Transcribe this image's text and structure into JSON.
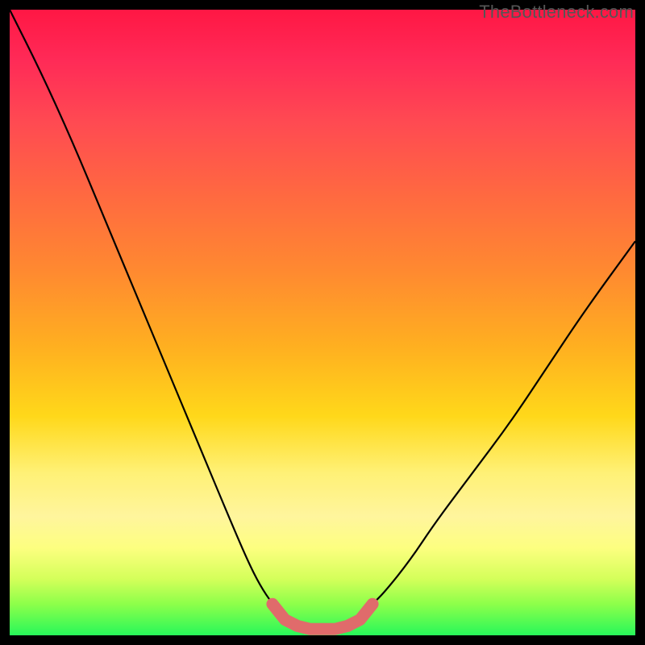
{
  "watermark": "TheBottleneck.com",
  "chart_data": {
    "type": "line",
    "title": "",
    "xlabel": "",
    "ylabel": "",
    "xlim": [
      0,
      100
    ],
    "ylim": [
      0,
      100
    ],
    "annotations": [],
    "series": [
      {
        "name": "left-curve",
        "x": [
          0,
          5,
          10,
          15,
          20,
          25,
          30,
          35,
          38,
          40,
          42,
          44,
          46
        ],
        "y": [
          100,
          90,
          79,
          67,
          55,
          43,
          31,
          19,
          12,
          8,
          5,
          3,
          2
        ]
      },
      {
        "name": "right-curve",
        "x": [
          54,
          56,
          58,
          60,
          64,
          68,
          74,
          80,
          86,
          92,
          100
        ],
        "y": [
          2,
          3,
          5,
          7,
          12,
          18,
          26,
          34,
          43,
          52,
          63
        ]
      },
      {
        "name": "trough-highlight",
        "x": [
          42,
          44,
          46,
          48,
          50,
          52,
          54,
          56,
          58
        ],
        "y": [
          5,
          2.5,
          1.5,
          1,
          1,
          1,
          1.5,
          2.5,
          5
        ]
      }
    ],
    "background_gradient": {
      "top": "#ff1744",
      "upper_mid": "#ff8a30",
      "mid": "#ffd81a",
      "lower_mid": "#fff59d",
      "bottom": "#27f75a"
    }
  }
}
